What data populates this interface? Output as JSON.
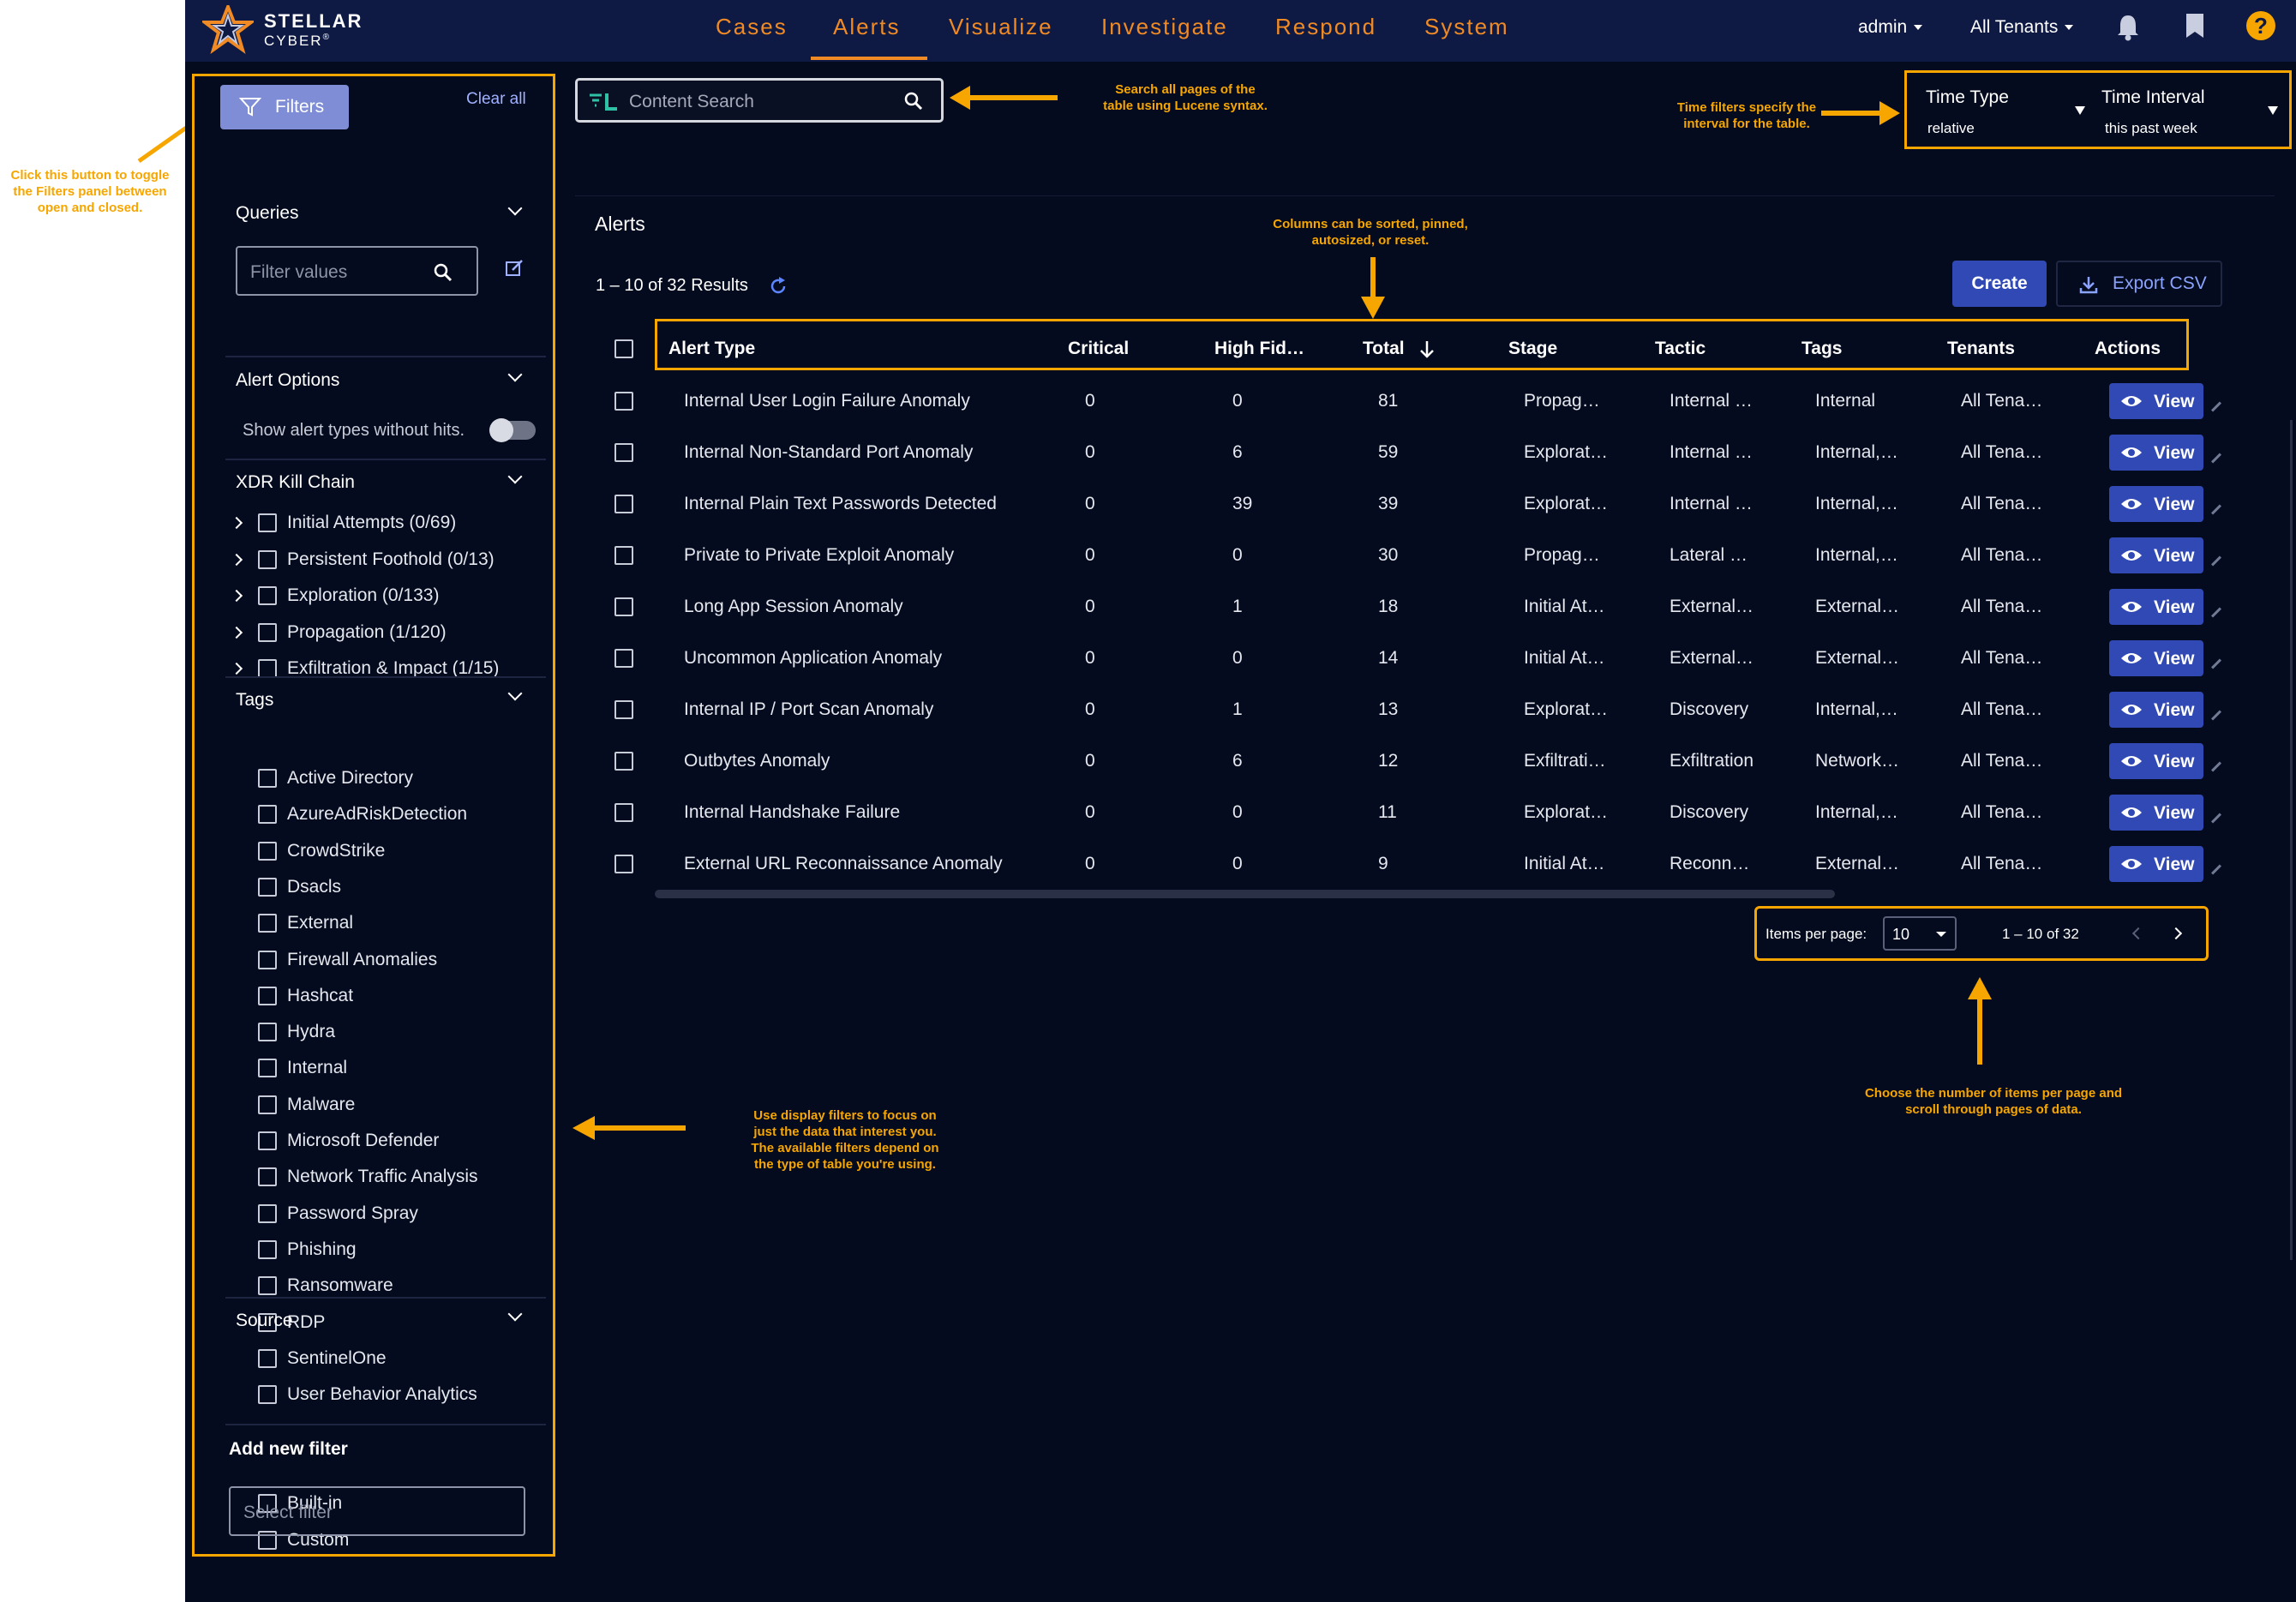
{
  "annotations": {
    "filters_toggle": "Click this button to toggle\nthe Filters panel between\nopen and closed.",
    "search": "Search all pages of the\ntable using Lucene syntax.",
    "time_filters": "Time filters specify the\ninterval for the table.",
    "columns": "Columns can be sorted, pinned,\nautosized, or reset.",
    "display_filters": "Use display filters to focus on\njust the data that interest you.\nThe available filters depend on\nthe type of table you're using.",
    "pagination": "Choose the number of items per page and\nscroll through pages of data."
  },
  "brand": {
    "line1": "STELLAR",
    "line2": "CYBER",
    "reg": "®"
  },
  "nav": [
    "Cases",
    "Alerts",
    "Visualize",
    "Investigate",
    "Respond",
    "System"
  ],
  "active_nav": "Alerts",
  "user": "admin",
  "tenants": "All Tenants",
  "filters_button": "Filters",
  "clear_all": "Clear all",
  "queries": {
    "title": "Queries",
    "placeholder": "Filter values"
  },
  "alert_options": {
    "title": "Alert Options",
    "toggle_label": "Show alert types without hits."
  },
  "kill_chain": {
    "title": "XDR Kill Chain",
    "items": [
      "Initial Attempts (0/69)",
      "Persistent Foothold (0/13)",
      "Exploration (0/133)",
      "Propagation (1/120)",
      "Exfiltration & Impact (1/15)"
    ]
  },
  "tags": {
    "title": "Tags",
    "items": [
      "Active Directory",
      "AzureAdRiskDetection",
      "CrowdStrike",
      "Dsacls",
      "External",
      "Firewall Anomalies",
      "Hashcat",
      "Hydra",
      "Internal",
      "Malware",
      "Microsoft Defender",
      "Network Traffic Analysis",
      "Password Spray",
      "Phishing",
      "Ransomware",
      "RDP",
      "SentinelOne",
      "User Behavior Analytics"
    ]
  },
  "source": {
    "title": "Source",
    "items": [
      "Built-in",
      "Custom"
    ]
  },
  "add_filter": {
    "title": "Add new filter",
    "placeholder": "Select filter"
  },
  "search": {
    "placeholder": "Content Search"
  },
  "time_type": {
    "label": "Time Type",
    "value": "relative"
  },
  "time_interval": {
    "label": "Time Interval",
    "value": "this past week"
  },
  "table": {
    "title": "Alerts",
    "results": "1 – 10 of 32 Results",
    "create": "Create",
    "export": "Export CSV",
    "view_label": "View",
    "columns": [
      "Alert Type",
      "Critical",
      "High Fid…",
      "Total",
      "Stage",
      "Tactic",
      "Tags",
      "Tenants",
      "Actions"
    ],
    "rows": [
      [
        "Internal User Login Failure Anomaly",
        "0",
        "0",
        "81",
        "Propag…",
        "Internal …",
        "Internal",
        "All Tena…"
      ],
      [
        "Internal Non-Standard Port Anomaly",
        "0",
        "6",
        "59",
        "Explorat…",
        "Internal …",
        "Internal,…",
        "All Tena…"
      ],
      [
        "Internal Plain Text Passwords Detected",
        "0",
        "39",
        "39",
        "Explorat…",
        "Internal …",
        "Internal,…",
        "All Tena…"
      ],
      [
        "Private to Private Exploit Anomaly",
        "0",
        "0",
        "30",
        "Propag…",
        "Lateral …",
        "Internal,…",
        "All Tena…"
      ],
      [
        "Long App Session Anomaly",
        "0",
        "1",
        "18",
        "Initial At…",
        "External…",
        "External…",
        "All Tena…"
      ],
      [
        "Uncommon Application Anomaly",
        "0",
        "0",
        "14",
        "Initial At…",
        "External…",
        "External…",
        "All Tena…"
      ],
      [
        "Internal IP / Port Scan Anomaly",
        "0",
        "1",
        "13",
        "Explorat…",
        "Discovery",
        "Internal,…",
        "All Tena…"
      ],
      [
        "Outbytes Anomaly",
        "0",
        "6",
        "12",
        "Exfiltrati…",
        "Exfiltration",
        "Network…",
        "All Tena…"
      ],
      [
        "Internal Handshake Failure",
        "0",
        "0",
        "11",
        "Explorat…",
        "Discovery",
        "Internal,…",
        "All Tena…"
      ],
      [
        "External URL Reconnaissance Anomaly",
        "0",
        "0",
        "9",
        "Initial At…",
        "Reconn…",
        "External…",
        "All Tena…"
      ]
    ]
  },
  "pagination": {
    "label": "Items per page:",
    "value": "10",
    "range": "1 – 10 of 32"
  },
  "colors": {
    "accent": "#f7a600",
    "nav_text": "#f08a24",
    "primary_button": "#3149b5",
    "background": "#050b1e",
    "topbar": "#0e1a44"
  }
}
